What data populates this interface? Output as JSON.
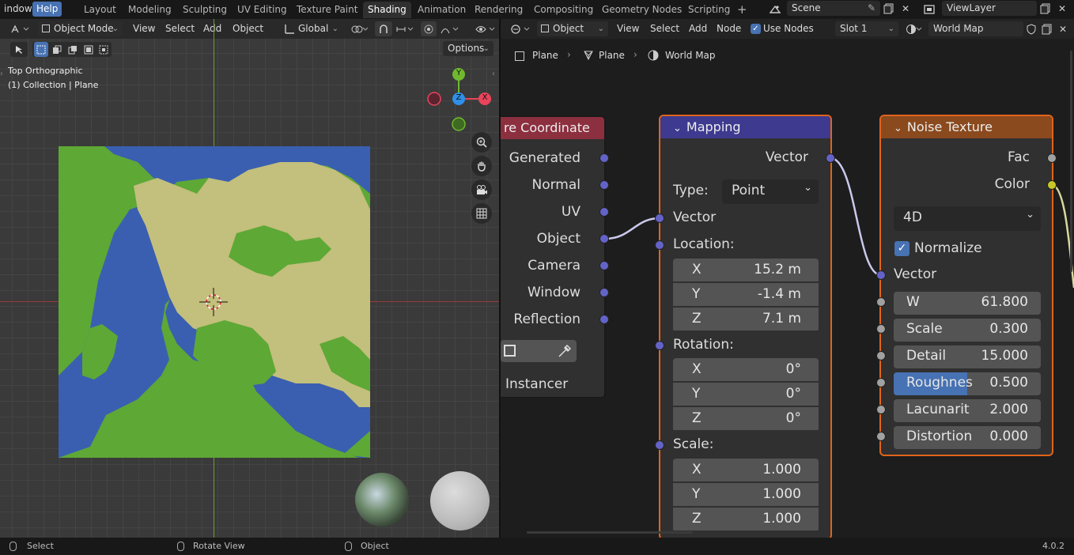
{
  "topbar": {
    "menus": [
      "indow",
      "Help"
    ],
    "workspaces": [
      "Layout",
      "Modeling",
      "Sculpting",
      "UV Editing",
      "Texture Paint",
      "Shading",
      "Animation",
      "Rendering",
      "Compositing",
      "Geometry Nodes",
      "Scripting"
    ],
    "active_workspace": "Shading",
    "add_tab_glyph": "+",
    "scene_name": "Scene",
    "view_layer_name": "ViewLayer"
  },
  "viewport": {
    "mode": "Object Mode",
    "menus": [
      "View",
      "Select",
      "Add",
      "Object"
    ],
    "transform_orientation": "Global",
    "options_label": "Options",
    "view_name": "Top Orthographic",
    "collection_info": "(1) Collection | Plane",
    "gizmo_axes": {
      "y": "Y",
      "z": "Z",
      "x": "X"
    }
  },
  "node_editor": {
    "type": "Object",
    "menus": [
      "View",
      "Select",
      "Add",
      "Node"
    ],
    "use_nodes_label": "Use Nodes",
    "use_nodes_checked": true,
    "slot": "Slot 1",
    "material": "World Map",
    "breadcrumb": [
      "Plane",
      "Plane",
      "World Map"
    ],
    "texcoord_node": {
      "title": "re Coordinate",
      "outputs": [
        "Generated",
        "Normal",
        "UV",
        "Object",
        "Camera",
        "Window",
        "Reflection"
      ],
      "instancer_label": "Instancer"
    },
    "mapping_node": {
      "title": "Mapping",
      "output": "Vector",
      "type_label": "Type:",
      "type_value": "Point",
      "vector_input": "Vector",
      "location_label": "Location:",
      "location": [
        {
          "k": "X",
          "v": "15.2 m"
        },
        {
          "k": "Y",
          "v": "-1.4 m"
        },
        {
          "k": "Z",
          "v": "7.1 m"
        }
      ],
      "rotation_label": "Rotation:",
      "rotation": [
        {
          "k": "X",
          "v": "0°"
        },
        {
          "k": "Y",
          "v": "0°"
        },
        {
          "k": "Z",
          "v": "0°"
        }
      ],
      "scale_label": "Scale:",
      "scale": [
        {
          "k": "X",
          "v": "1.000"
        },
        {
          "k": "Y",
          "v": "1.000"
        },
        {
          "k": "Z",
          "v": "1.000"
        }
      ]
    },
    "noise_node": {
      "title": "Noise Texture",
      "outputs": [
        "Fac",
        "Color"
      ],
      "dimensions": "4D",
      "normalize_label": "Normalize",
      "normalize_checked": true,
      "vector_input": "Vector",
      "fields": [
        {
          "k": "W",
          "v": "61.800"
        },
        {
          "k": "Scale",
          "v": "0.300"
        },
        {
          "k": "Detail",
          "v": "15.000"
        },
        {
          "k": "Roughnes",
          "v": "0.500",
          "fill": 0.5
        },
        {
          "k": "Lacunarit",
          "v": "2.000"
        },
        {
          "k": "Distortion",
          "v": "0.000"
        }
      ]
    }
  },
  "statusbar": {
    "items": [
      "Select",
      "Rotate View",
      "Object"
    ],
    "version": "4.0.2"
  },
  "colors": {
    "accent": "#4772b3",
    "node_border": "#e0641a",
    "texcoord_header": "#8c2f3f",
    "mapping_header": "#3e3a90",
    "noise_header": "#8a4a1e",
    "vector_socket": "#6363c7",
    "float_socket": "#a1a1a1",
    "color_socket": "#c7c729",
    "water": "#3a5fb0",
    "land": "#c3bf7c",
    "forest": "#5ea836"
  }
}
